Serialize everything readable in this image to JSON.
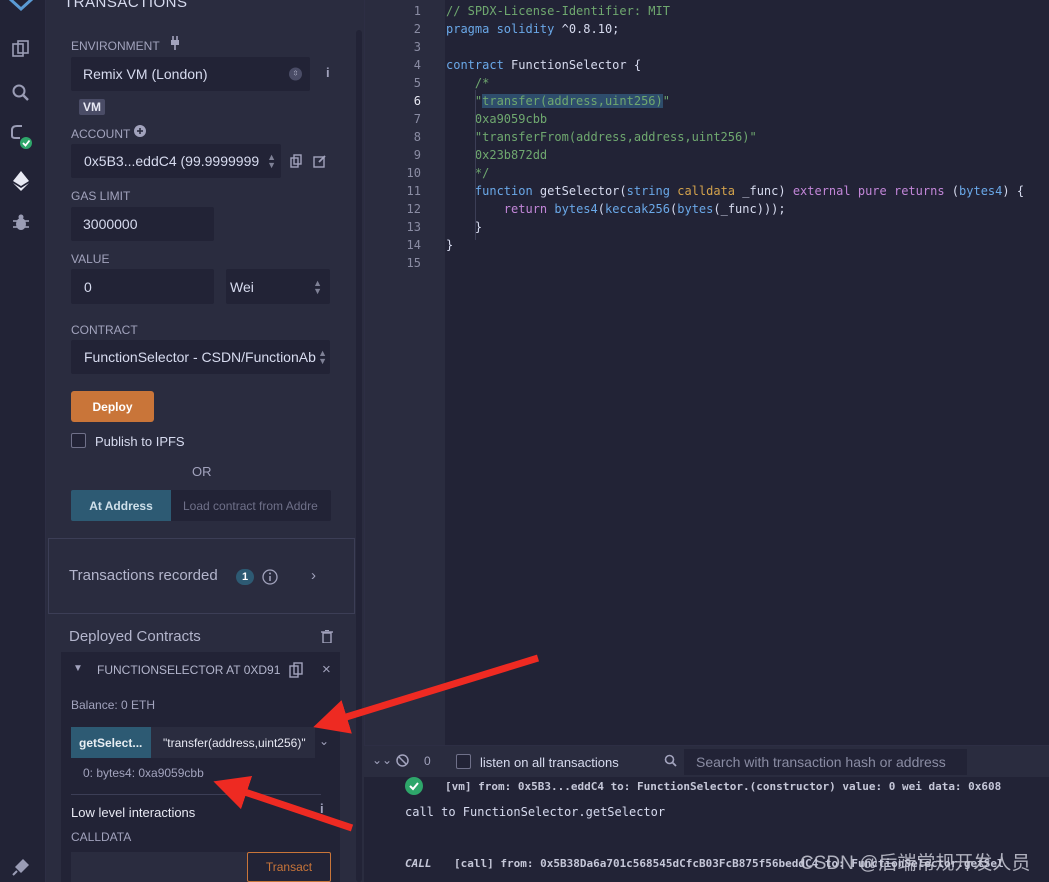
{
  "panel": {
    "title": "TRANSACTIONS",
    "environment_label": "ENVIRONMENT",
    "environment_value": "Remix VM (London)",
    "vm_badge": "VM",
    "account_label": "ACCOUNT",
    "account_value": "0x5B3...eddC4 (99.9999999",
    "gas_limit_label": "GAS LIMIT",
    "gas_limit_value": "3000000",
    "value_label": "VALUE",
    "value_amount": "0",
    "value_unit": "Wei",
    "contract_label": "CONTRACT",
    "contract_value": "FunctionSelector - CSDN/FunctionAb",
    "deploy_label": "Deploy",
    "publish_label": "Publish to IPFS",
    "or_label": "OR",
    "at_address_label": "At Address",
    "at_address_placeholder": "Load contract from Addre",
    "recorded_title": "Transactions recorded",
    "recorded_count": "1",
    "deployed_title": "Deployed Contracts",
    "instance": {
      "name": "FUNCTIONSELECTOR AT 0XD91",
      "balance": "Balance: 0 ETH",
      "fn_button": "getSelect...",
      "fn_input": "\"transfer(address,uint256)\"",
      "fn_output": "0: bytes4: 0xa9059cbb",
      "low_level": "Low level interactions",
      "calldata_label": "CALLDATA",
      "transact_label": "Transact"
    }
  },
  "editor": {
    "line_numbers": [
      "1",
      "2",
      "3",
      "4",
      "5",
      "6",
      "7",
      "8",
      "9",
      "10",
      "11",
      "12",
      "13",
      "14",
      "15"
    ],
    "active_line": "6"
  },
  "terminal": {
    "pending_count": "0",
    "listen_label": "listen on all transactions",
    "search_placeholder": "Search with transaction hash or address",
    "log1": "[vm]  from: 0x5B3...eddC4 to: FunctionSelector.(constructor) value: 0 wei data: 0x608",
    "log2": "call to FunctionSelector.getSelector",
    "log3_tag": "CALL",
    "log3": "[call]  from: 0x5B38Da6a701c568545dCfcB03FcB875f56beddC4 to: FunctionSelector.getSel"
  },
  "watermark": "CSDN @后端常规开发人员",
  "colors": {
    "accent": "#c97539",
    "primary": "#2d5a73",
    "background": "#222336",
    "panel": "#2a2c3f",
    "arrow": "#ee2a22"
  }
}
